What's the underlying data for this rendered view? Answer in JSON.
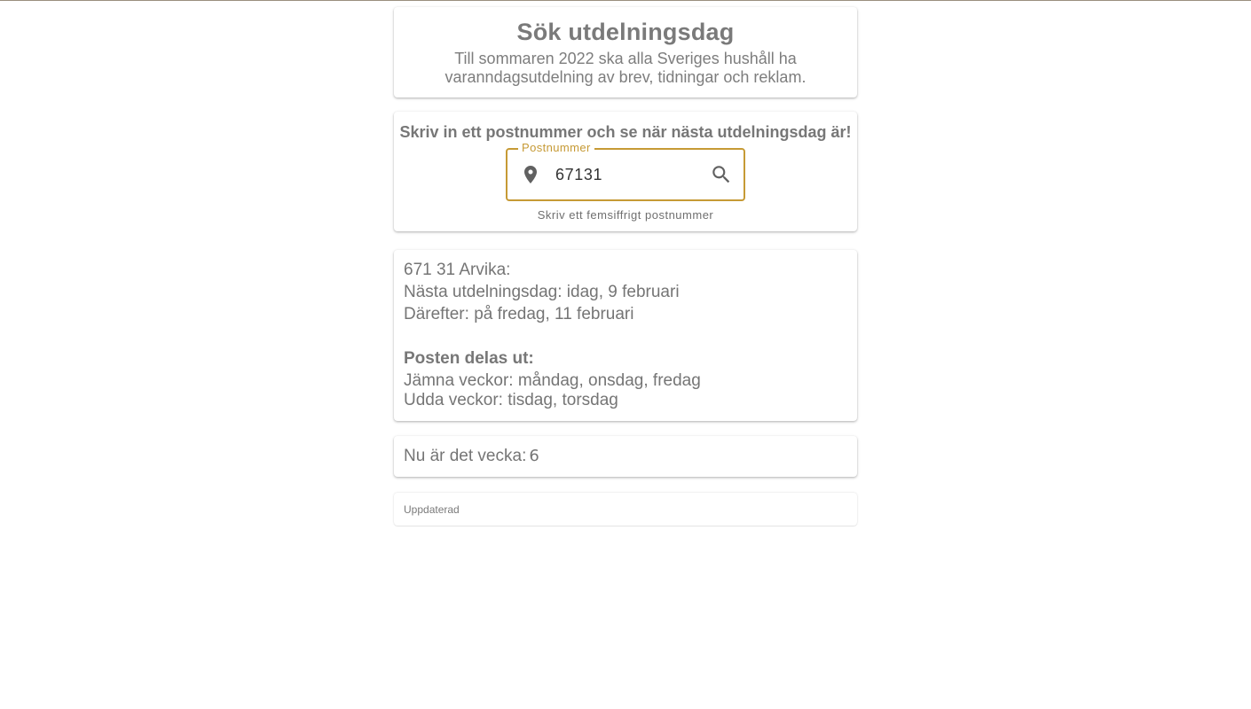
{
  "header": {
    "title": "Sök utdelningsdag",
    "subtitle_line1": "Till sommaren 2022 ska alla Sveriges hushåll ha",
    "subtitle_line2": "varanndagsutdelning av brev, tidningar och reklam."
  },
  "search": {
    "prompt": "Skriv in ett postnummer och se när nästa utdelningsdag är!",
    "field_label": "Postnummer",
    "value": "67131",
    "helper": "Skriv ett femsiffrigt postnummer",
    "leading_icon": "location-pin-icon",
    "trailing_icon": "search-icon",
    "accent_color": "#c69a35"
  },
  "result": {
    "location": "671 31 Arvika:",
    "next_day": "Nästa utdelningsdag: idag, 9 februari",
    "after": "Därefter: på fredag, 11 februari",
    "schedule_heading": "Posten delas ut:",
    "even_weeks": "Jämna veckor: måndag, onsdag, fredag",
    "odd_weeks": "Udda veckor: tisdag, torsdag"
  },
  "week": {
    "label": "Nu är det vecka:",
    "number": "6"
  },
  "updated": {
    "label": "Uppdaterad"
  }
}
